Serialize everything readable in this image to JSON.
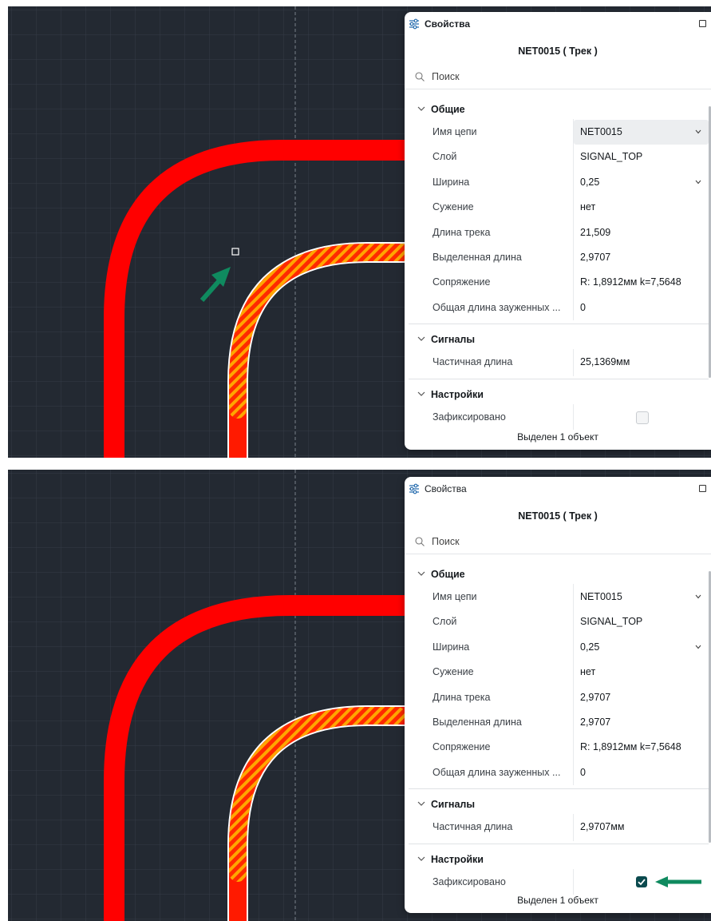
{
  "panels": [
    {
      "title": "Свойства",
      "object_title": "NET0015 ( Трек )",
      "search_placeholder": "Поиск",
      "sections": {
        "general": {
          "label": "Общие",
          "rows": [
            {
              "key": "Имя цепи",
              "value": "NET0015"
            },
            {
              "key": "Слой",
              "value": "SIGNAL_TOP"
            },
            {
              "key": "Ширина",
              "value": "0,25"
            },
            {
              "key": "Сужение",
              "value": "нет"
            },
            {
              "key": "Длина трека",
              "value": "21,509"
            },
            {
              "key": "Выделенная длина",
              "value": "2,9707"
            },
            {
              "key": "Сопряжение",
              "value": "R: 1,8912мм k=7,5648"
            },
            {
              "key": "Общая длина зауженных ...",
              "value": "0"
            }
          ]
        },
        "signals": {
          "label": "Сигналы",
          "rows": [
            {
              "key": "Частичная длина",
              "value": "25,1369мм"
            }
          ]
        },
        "settings": {
          "label": "Настройки",
          "rows": [
            {
              "key": "Зафиксировано",
              "checked": false
            }
          ]
        }
      },
      "footer": "Выделен 1 объект"
    },
    {
      "title": "Свойства",
      "object_title": "NET0015 ( Трек )",
      "search_placeholder": "Поиск",
      "sections": {
        "general": {
          "label": "Общие",
          "rows": [
            {
              "key": "Имя цепи",
              "value": "NET0015"
            },
            {
              "key": "Слой",
              "value": "SIGNAL_TOP"
            },
            {
              "key": "Ширина",
              "value": "0,25"
            },
            {
              "key": "Сужение",
              "value": "нет"
            },
            {
              "key": "Длина трека",
              "value": "2,9707"
            },
            {
              "key": "Выделенная длина",
              "value": "2,9707"
            },
            {
              "key": "Сопряжение",
              "value": "R: 1,8912мм k=7,5648"
            },
            {
              "key": "Общая длина зауженных ...",
              "value": "0"
            }
          ]
        },
        "signals": {
          "label": "Сигналы",
          "rows": [
            {
              "key": "Частичная длина",
              "value": "2,9707мм"
            }
          ]
        },
        "settings": {
          "label": "Настройки",
          "rows": [
            {
              "key": "Зафиксировано",
              "checked": true
            }
          ]
        }
      },
      "footer": "Выделен 1 объект"
    }
  ],
  "colors": {
    "canvas_bg": "#232932",
    "grid": "#343c47",
    "track": "#ff0000",
    "highlight_stripe": "#ffa600",
    "annotation_arrow": "#0f8a5f",
    "checkbox_checked": "#0b4a4e"
  }
}
